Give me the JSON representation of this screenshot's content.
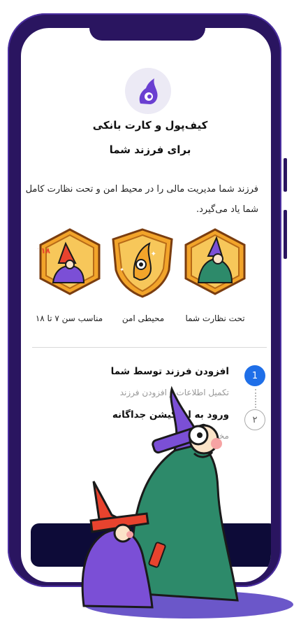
{
  "header": {
    "title_line1": "کیف‌پول و کارت بانکی",
    "title_line2": "برای فرزند شما"
  },
  "description": "فرزند شما مدیریت مالی را در محیط امن و تحت نظارت کامل شما یاد می‌گیرد.",
  "features": [
    {
      "label": "تحت نظارت شما",
      "icon": "wizard-cloak-badge-icon"
    },
    {
      "label": "محیطی امن",
      "icon": "shield-eye-badge-icon"
    },
    {
      "label": "مناسب سن ۷ تا ۱۸",
      "icon": "age-wizard-badge-icon"
    }
  ],
  "badge_age_text": "۱۸ ۷",
  "steps": [
    {
      "number": "1",
      "title": "افزودن فرزند توسط شما",
      "subtitle": "تکمیل اطلاعات و افزودن فرزند"
    },
    {
      "number": "۲",
      "title": "ورود به اپلیکیشن جداگانه",
      "subtitle": "مخصوص فرزند"
    }
  ],
  "colors": {
    "phone_frame": "#2a1560",
    "accent_blue": "#1f6fe8",
    "cta_background": "#0d0b38",
    "logo_purple": "#6a3fd1"
  }
}
